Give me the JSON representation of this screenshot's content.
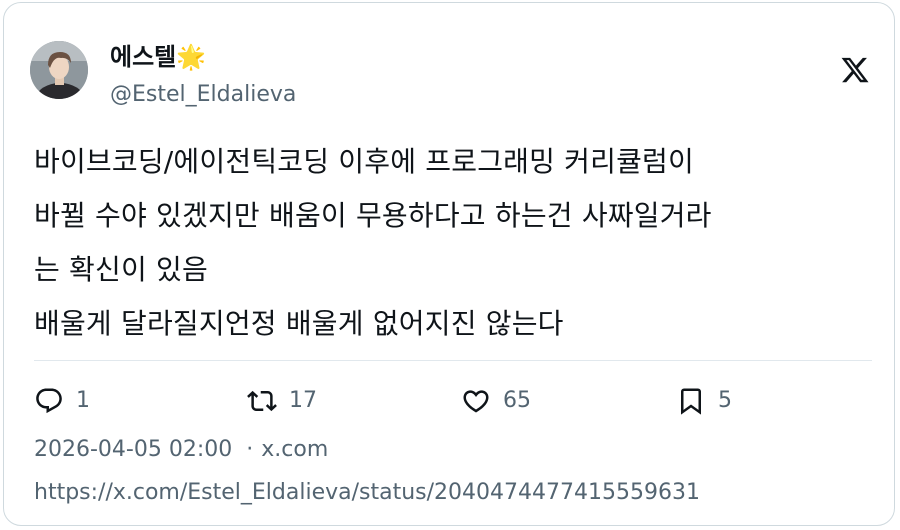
{
  "author": {
    "display_name": "에스텔",
    "name_emoji": "🌟",
    "handle": "@Estel_Eldalieva",
    "avatar_icon": "profile-photo"
  },
  "platform_icon": "x-logo-icon",
  "tweet": {
    "text": "바이브코딩/에이전틱코딩 이후에 프로그래밍 커리큘럼이\n바뀔 수야 있겠지만 배움이 무용하다고 하는건 사짜일거라\n는 확신이 있음\n배울게 달라질지언정 배울게 없어지진 않는다"
  },
  "actions": {
    "reply": {
      "icon": "reply-icon",
      "count": "1"
    },
    "retweet": {
      "icon": "retweet-icon",
      "count": "17"
    },
    "like": {
      "icon": "heart-icon",
      "count": "65"
    },
    "bookmark": {
      "icon": "bookmark-icon",
      "count": "5"
    }
  },
  "meta": {
    "timestamp": "2026-04-05 02:00",
    "separator": "·",
    "source": "x.com",
    "url": "https://x.com/Estel_Eldalieva/status/2040474477415559631"
  },
  "colors": {
    "text_primary": "#0f1419",
    "text_secondary": "#536471",
    "border": "#cfd9de"
  }
}
